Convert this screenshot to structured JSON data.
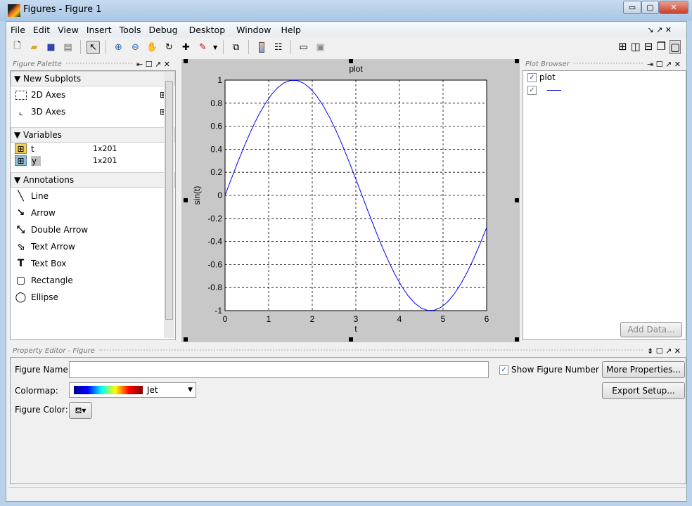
{
  "window": {
    "title": "Figures - Figure 1",
    "minimize": "▭",
    "maximize": "▢",
    "close": "✕"
  },
  "menu": [
    "File",
    "Edit",
    "View",
    "Insert",
    "Tools",
    "Debug",
    "Desktop",
    "Window",
    "Help"
  ],
  "palette": {
    "title": "Figure Palette",
    "sections": {
      "subplots": "New Subplots",
      "variables": "Variables",
      "annotations": "Annotations"
    },
    "subplots": [
      {
        "label": "2D Axes"
      },
      {
        "label": "3D Axes"
      }
    ],
    "variables": [
      {
        "name": "t",
        "size": "1x201"
      },
      {
        "name": "y",
        "size": "1x201"
      }
    ],
    "annotations": [
      {
        "label": "Line",
        "icon": "line-icon"
      },
      {
        "label": "Arrow",
        "icon": "arrow-icon"
      },
      {
        "label": "Double Arrow",
        "icon": "double-arrow-icon"
      },
      {
        "label": "Text Arrow",
        "icon": "text-arrow-icon"
      },
      {
        "label": "Text Box",
        "icon": "text-box-icon"
      },
      {
        "label": "Rectangle",
        "icon": "rectangle-icon"
      },
      {
        "label": "Ellipse",
        "icon": "ellipse-icon"
      }
    ]
  },
  "plot_browser": {
    "title": "Plot Browser",
    "items": [
      "plot",
      ""
    ],
    "add_data": "Add Data..."
  },
  "property_editor": {
    "title": "Property Editor - Figure",
    "figure_name_label": "Figure Name:",
    "figure_name_value": "",
    "show_number_label": "Show Figure Number",
    "show_number_checked": true,
    "colormap_label": "Colormap:",
    "colormap_value": "Jet",
    "figure_color_label": "Figure Color:",
    "more_properties": "More Properties...",
    "export_setup": "Export Setup..."
  },
  "chart_data": {
    "type": "line",
    "title": "plot",
    "xlabel": "t",
    "ylabel": "sin(t)",
    "xlim": [
      0,
      6
    ],
    "ylim": [
      -1,
      1
    ],
    "grid": true,
    "xticks": [
      "0",
      "1",
      "2",
      "3",
      "4",
      "5",
      "6"
    ],
    "yticks": [
      "1",
      "0.8",
      "0.6",
      "0.4",
      "0.2",
      "0",
      "-0.2",
      "-0.4",
      "-0.6",
      "-0.8",
      "-1"
    ],
    "color": "#0000ff",
    "x": [
      0,
      0.15,
      0.3,
      0.45,
      0.6,
      0.75,
      0.9,
      1.05,
      1.2,
      1.35,
      1.5,
      1.65,
      1.8,
      1.95,
      2.1,
      2.25,
      2.4,
      2.55,
      2.7,
      2.85,
      3.0,
      3.15,
      3.3,
      3.45,
      3.6,
      3.75,
      3.9,
      4.05,
      4.2,
      4.35,
      4.5,
      4.65,
      4.8,
      4.95,
      5.1,
      5.25,
      5.4,
      5.55,
      5.7,
      5.85,
      6.0
    ],
    "y": [
      0,
      0.149,
      0.296,
      0.435,
      0.565,
      0.682,
      0.783,
      0.867,
      0.932,
      0.976,
      0.997,
      0.997,
      0.974,
      0.929,
      0.863,
      0.778,
      0.675,
      0.558,
      0.427,
      0.287,
      0.141,
      -0.008,
      -0.158,
      -0.304,
      -0.443,
      -0.572,
      -0.688,
      -0.788,
      -0.872,
      -0.935,
      -0.978,
      -0.998,
      -0.996,
      -0.972,
      -0.926,
      -0.859,
      -0.773,
      -0.669,
      -0.551,
      -0.419,
      -0.279
    ]
  }
}
